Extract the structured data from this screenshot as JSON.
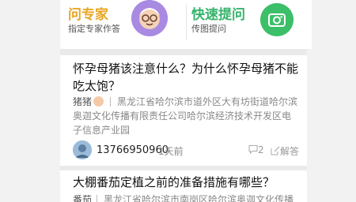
{
  "expert": {
    "title": "问专家",
    "subtitle": "指定专家作答"
  },
  "quick": {
    "title": "快速提问",
    "subtitle": "传图提问"
  },
  "questions": [
    {
      "title": "怀孕母猪该注意什么？为什么怀孕母猪不能吃太饱？",
      "user": "猪猪",
      "location": "黑龙江省哈尔滨市道外区大有坊街道哈尔滨奥迦文化传播有限责任公司哈尔滨经济技术开发区电子信息产业园",
      "phone": "13766950960",
      "time": "1天前",
      "comments": "2",
      "answer_label": "解答"
    },
    {
      "title": "大棚番茄定植之前的准备措施有哪些？",
      "user": "番茄",
      "location": "黑龙江省哈尔滨市南岗区哈尔滨奥迦文化传播"
    }
  ]
}
